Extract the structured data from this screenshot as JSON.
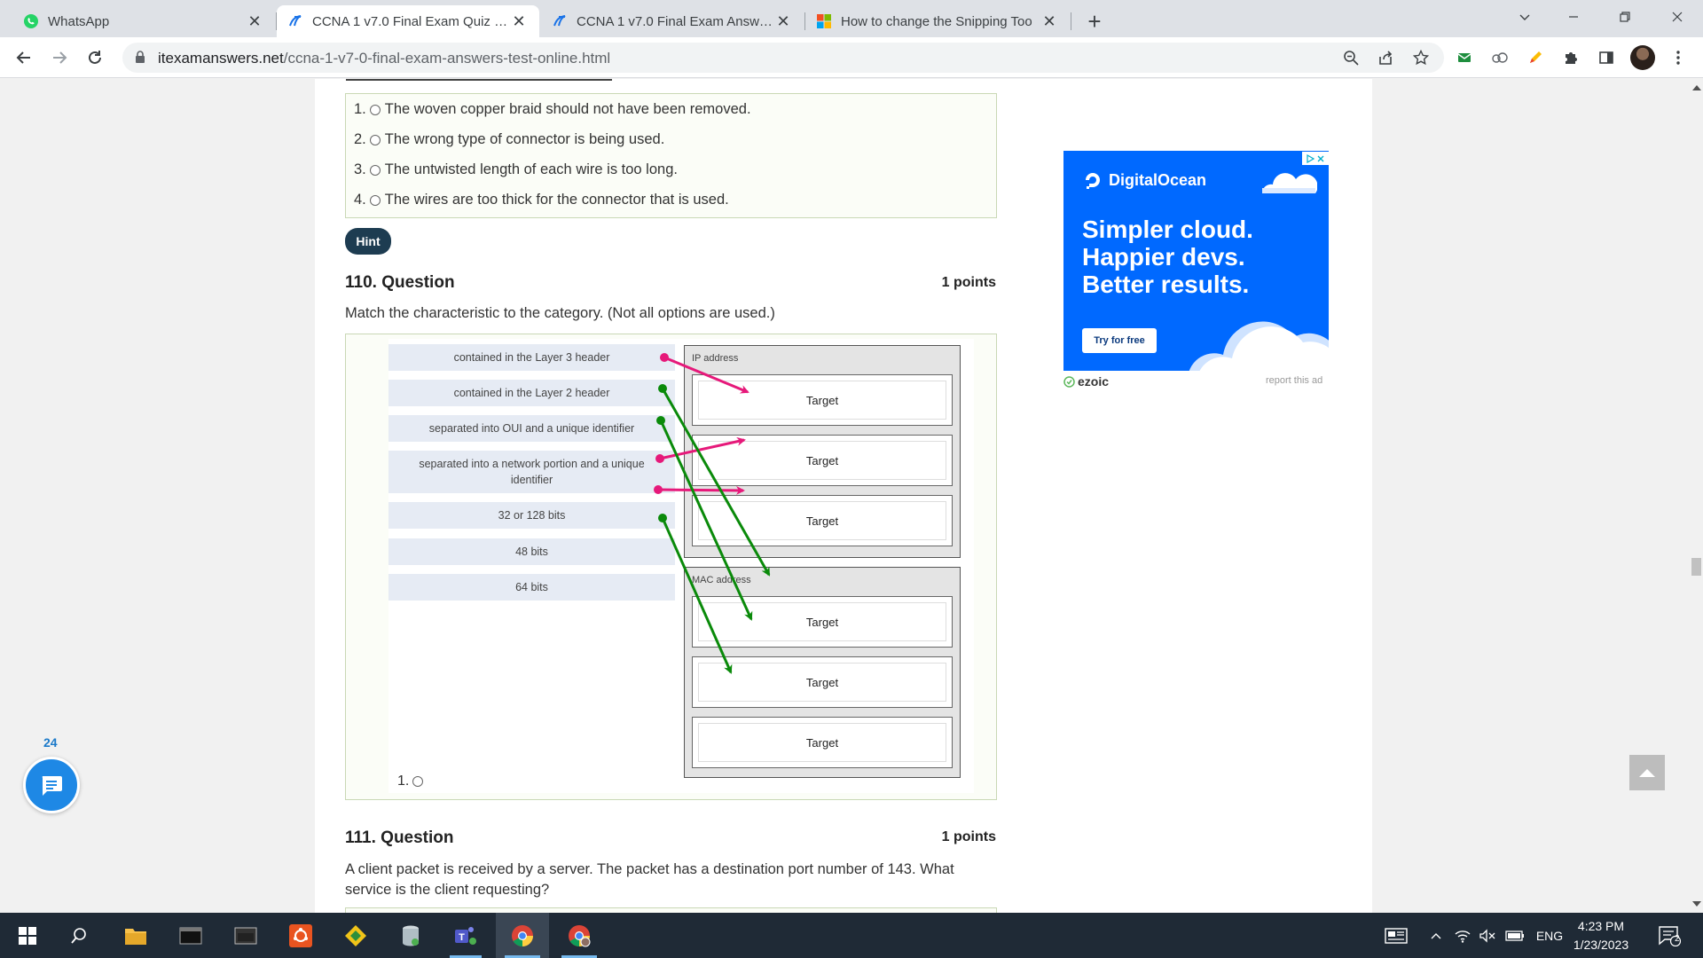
{
  "browser": {
    "tabs": [
      {
        "title": "WhatsApp",
        "icon": "whatsapp-icon",
        "active": false
      },
      {
        "title": "CCNA 1 v7.0 Final Exam Quiz – Te",
        "icon": "itexam-icon",
        "active": true
      },
      {
        "title": "CCNA 1 v7.0 Final Exam Answers",
        "icon": "itexam-icon",
        "active": false
      },
      {
        "title": "How to change the Snipping Too",
        "icon": "microsoft-icon",
        "active": false
      }
    ],
    "url_domain": "itexamanswers.net",
    "url_path": "/ccna-1-v7-0-final-exam-answers-test-online.html"
  },
  "prev_question": {
    "answers": [
      {
        "num": "1.",
        "text": "The woven copper braid should not have been removed."
      },
      {
        "num": "2.",
        "text": "The wrong type of connector is being used."
      },
      {
        "num": "3.",
        "text": "The untwisted length of each wire is too long."
      },
      {
        "num": "4.",
        "text": "The wires are too thick for the connector that is used."
      }
    ],
    "hint_label": "Hint"
  },
  "question_110": {
    "title": "110. Question",
    "points": "1 points",
    "text": "Match the characteristic to the category. (Not all options are used.)",
    "options": [
      "contained in the Layer 3 header",
      "contained in the Layer 2 header",
      "separated into OUI and a unique identifier",
      "separated into a network portion and a unique identifier",
      "32 or 128 bits",
      "48 bits",
      "64 bits"
    ],
    "groups": [
      {
        "label": "IP address",
        "targets": [
          "Target",
          "Target",
          "Target"
        ]
      },
      {
        "label": "MAC address",
        "targets": [
          "Target",
          "Target",
          "Target"
        ]
      }
    ],
    "answer_radio": "1.",
    "arrow_colors": {
      "ip": "#e6197a",
      "mac": "#0a8a0a"
    }
  },
  "question_111": {
    "title": "111. Question",
    "points": "1 points",
    "text_line1": "A client packet is received by a server. The packet has a destination port number of 143. What",
    "text_line2": "service is the client requesting?"
  },
  "ad": {
    "brand": "DigitalOcean",
    "headline1": "Simpler cloud.",
    "headline2": "Happier devs.",
    "headline3": "Better results.",
    "cta": "Try for free",
    "network": "ezoic",
    "report": "report this ad",
    "bg_color": "#0069ff"
  },
  "widgets": {
    "chat_count": "24"
  },
  "taskbar": {
    "language": "ENG",
    "time": "4:23 PM",
    "date": "1/23/2023",
    "notifications": "2"
  }
}
